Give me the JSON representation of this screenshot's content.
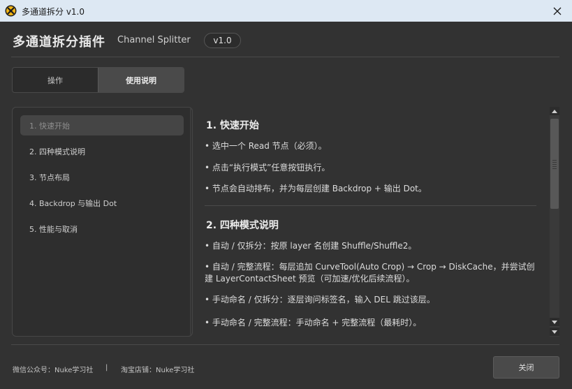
{
  "window": {
    "title": "多通道拆分  v1.0",
    "app_icon": "nuke-icon",
    "close_icon": "close-icon"
  },
  "header": {
    "title": "多通道拆分插件",
    "subtitle": "Channel Splitter",
    "version": "v1.0"
  },
  "tabs": [
    {
      "label": "操作",
      "active": false
    },
    {
      "label": "使用说明",
      "active": true
    }
  ],
  "nav": {
    "items": [
      {
        "label": "1. 快速开始",
        "active": true
      },
      {
        "label": "2. 四种模式说明",
        "active": false
      },
      {
        "label": "3. 节点布局",
        "active": false
      },
      {
        "label": "4. Backdrop 与输出 Dot",
        "active": false
      },
      {
        "label": "5. 性能与取消",
        "active": false
      }
    ]
  },
  "content": {
    "sections": [
      {
        "heading": "1. 快速开始",
        "paragraphs": [
          "• 选中一个 Read 节点（必须）。",
          "• 点击“执行模式”任意按钮执行。",
          "• 节点会自动排布，并为每层创建 Backdrop + 输出 Dot。"
        ]
      },
      {
        "heading": "2. 四种模式说明",
        "paragraphs": [
          "• 自动 / 仅拆分：按原 layer 名创建 Shuffle/Shuffle2。",
          "• 自动 / 完整流程：每层追加 CurveTool(Auto Crop) → Crop → DiskCache，并尝试创建 LayerContactSheet 预览（可加速/优化后续流程）。",
          "• 手动命名 / 仅拆分：逐层询问标签名，输入 DEL 跳过该层。",
          "• 手动命名 / 完整流程：手动命名 + 完整流程（最耗时）。"
        ]
      }
    ]
  },
  "footer": {
    "wechat": "微信公众号：Nuke学习社",
    "divider": "|",
    "shop": "淘宝店铺：Nuke学习社",
    "close_label": "关闭"
  },
  "colors": {
    "background": "#323232",
    "titlebar": "#dde8f3",
    "accent_logo": "#f2b516"
  }
}
